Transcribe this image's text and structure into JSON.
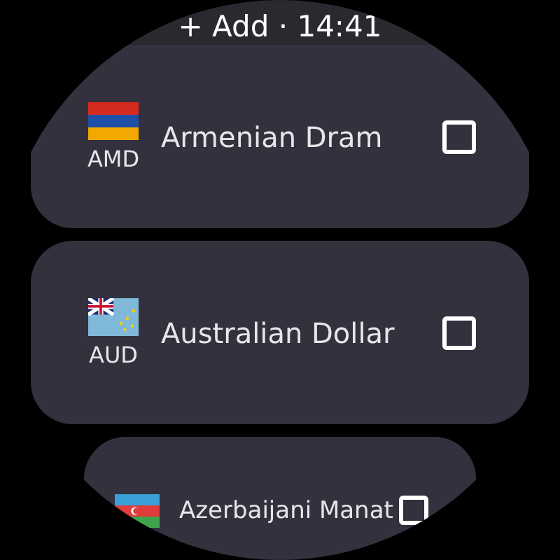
{
  "header": {
    "label": "+ Add · 14:41"
  },
  "currencies": [
    {
      "kind": "armenia",
      "code": "AMD",
      "name": "Armenian Dram",
      "checked": false
    },
    {
      "kind": "tuvalu",
      "code": "AUD",
      "name": "Australian Dollar",
      "checked": false
    },
    {
      "kind": "azerbaijan",
      "name": "Azerbaijani Manat",
      "checked": false
    }
  ]
}
